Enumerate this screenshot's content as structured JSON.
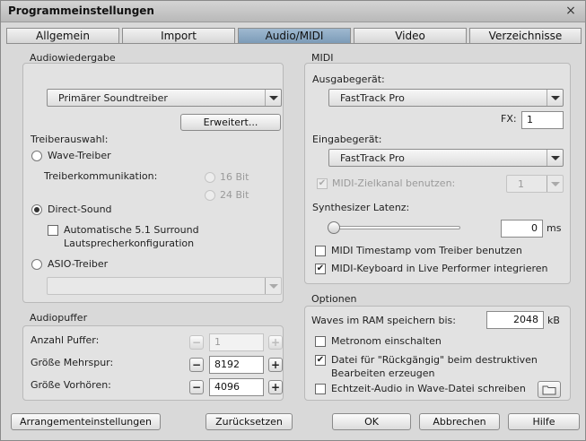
{
  "window": {
    "title": "Programmeinstellungen",
    "close_label": "×"
  },
  "tabs": [
    {
      "label": "Allgemein"
    },
    {
      "label": "Import"
    },
    {
      "label": "Audio/MIDI"
    },
    {
      "label": "Video"
    },
    {
      "label": "Verzeichnisse"
    }
  ],
  "audio_playback": {
    "title": "Audiowiedergabe",
    "driver_select": "Primärer Soundtreiber",
    "advanced_button": "Erweitert...",
    "driver_choice_label": "Treiberauswahl:",
    "wave_driver": "Wave-Treiber",
    "driver_comm_label": "Treiberkommunikation:",
    "bit16": "16 Bit",
    "bit24": "24 Bit",
    "direct_sound": "Direct-Sound",
    "surround_line1": "Automatische 5.1 Surround",
    "surround_line2": "Lautsprecherkonfiguration",
    "asio_driver": "ASIO-Treiber",
    "asio_select": ""
  },
  "audio_buffer": {
    "title": "Audiopuffer",
    "count_label": "Anzahl Puffer:",
    "count_value": "1",
    "multitrack_label": "Größe Mehrspur:",
    "multitrack_value": "8192",
    "preview_label": "Größe Vorhören:",
    "preview_value": "4096"
  },
  "midi": {
    "title": "MIDI",
    "output_label": "Ausgabegerät:",
    "output_value": "FastTrack Pro",
    "fx_label": "FX:",
    "fx_value": "1",
    "input_label": "Eingabegerät:",
    "input_value": "FastTrack Pro",
    "target_channel_label": "MIDI-Zielkanal benutzen:",
    "target_channel_value": "1",
    "latency_label": "Synthesizer Latenz:",
    "latency_value": "0",
    "latency_unit": "ms",
    "latency_level": 0,
    "timestamp_label": "MIDI Timestamp vom Treiber benutzen",
    "keyboard_label": "MIDI-Keyboard in Live Performer integrieren"
  },
  "options": {
    "title": "Optionen",
    "waves_label": "Waves im RAM speichern bis:",
    "waves_value": "2048",
    "waves_unit": "kB",
    "metronome_label": "Metronom einschalten",
    "undo_line1": "Datei für \"Rückgängig\" beim destruktiven",
    "undo_line2": "Bearbeiten erzeugen",
    "realtime_label": "Echtzeit-Audio in Wave-Datei schreiben"
  },
  "footer": {
    "arrangement_button": "Arrangementeinstellungen",
    "reset_button": "Zurücksetzen",
    "ok_button": "OK",
    "cancel_button": "Abbrechen",
    "help_button": "Hilfe"
  },
  "checkmark": "✔"
}
